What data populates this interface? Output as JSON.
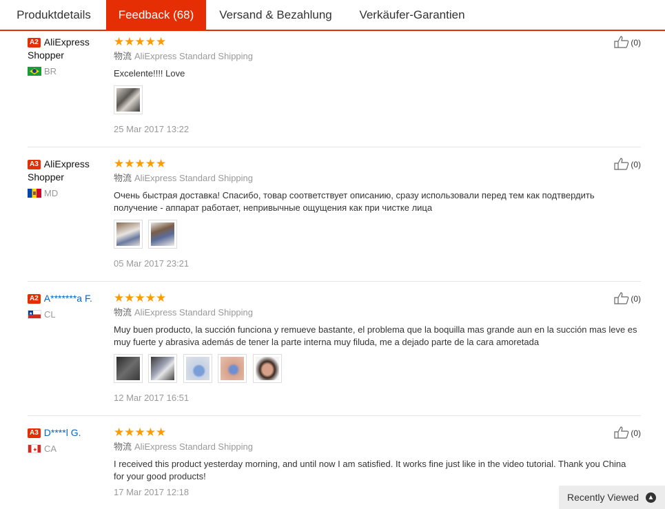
{
  "tabs": [
    {
      "label": "Produktdetails",
      "active": false
    },
    {
      "label": "Feedback (68)",
      "active": true
    },
    {
      "label": "Versand & Bezahlung",
      "active": false
    },
    {
      "label": "Verkäufer-Garantien",
      "active": false
    }
  ],
  "reviews": [
    {
      "level": "A2",
      "user": "AliExpress Shopper",
      "country": "BR",
      "flag_icon": "brazil-flag-icon",
      "stars": "★★★★★",
      "ship_prefix": "物流",
      "shipping": "AliExpress Standard Shipping",
      "text": "Excelente!!!! Love",
      "photos": 1,
      "date": "25 Mar 2017 13:22",
      "helpful": "(0)"
    },
    {
      "level": "A3",
      "user": "AliExpress Shopper",
      "country": "MD",
      "flag_icon": "moldova-flag-icon",
      "stars": "★★★★★",
      "ship_prefix": "物流",
      "shipping": "AliExpress Standard Shipping",
      "text": "Очень быстрая доставка! Спасибо, товар соответствует описанию, сразу использовали перед тем как подтвердить получение - аппарат работает, непривычные ощущения как при чистке лица",
      "photos": 2,
      "date": "05 Mar 2017 23:21",
      "helpful": "(0)"
    },
    {
      "level": "A2",
      "user": "A*******a F.",
      "country": "CL",
      "flag_icon": "chile-flag-icon",
      "stars": "★★★★★",
      "ship_prefix": "物流",
      "shipping": "AliExpress Standard Shipping",
      "text": "Muy buen producto, la succión funciona y remueve bastante, el problema que la boquilla mas grande aun en la succión mas leve es muy fuerte y abrasiva además de tener la parte interna muy filuda, me a dejado parte de la cara amoretada",
      "photos": 5,
      "date": "12 Mar 2017 16:51",
      "helpful": "(0)"
    },
    {
      "level": "A3",
      "user": "D****l G.",
      "country": "CA",
      "flag_icon": "canada-flag-icon",
      "stars": "★★★★★",
      "ship_prefix": "物流",
      "shipping": "AliExpress Standard Shipping",
      "text": "I received this product yesterday morning, and until now I am satisfied. It works fine just like in the video tutorial. Thank you China for your good products!",
      "photos": 0,
      "date": "17 Mar 2017 12:18",
      "helpful": "(0)"
    }
  ],
  "recently_viewed": {
    "label": "Recently Viewed",
    "icon": "chevron-up-icon"
  },
  "colors": {
    "accent": "#e62e04",
    "star": "#ff9a00",
    "link": "#0066cc"
  }
}
